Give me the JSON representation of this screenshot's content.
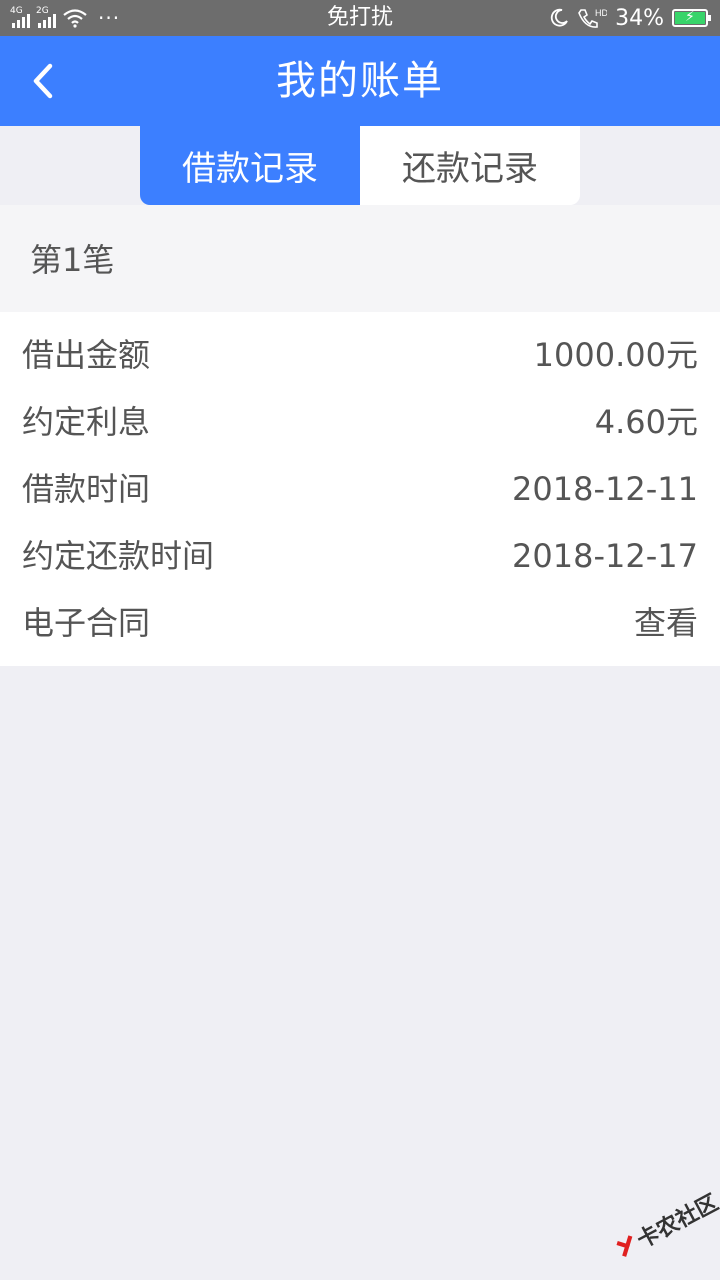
{
  "status_bar": {
    "network_1": "4G",
    "network_2": "2G",
    "more": "···",
    "mode": "免打扰",
    "battery_percent": "34%",
    "battery_level": 0.34,
    "icons": [
      "signal-icon",
      "wifi-icon",
      "moon-icon",
      "hd-call-icon",
      "battery-icon"
    ]
  },
  "header": {
    "title": "我的账单"
  },
  "tabs": [
    {
      "label": "借款记录",
      "active": true
    },
    {
      "label": "还款记录",
      "active": false
    }
  ],
  "section": {
    "title": "第1笔"
  },
  "details": [
    {
      "label": "借出金额",
      "value": "1000.00元"
    },
    {
      "label": "约定利息",
      "value": "4.60元"
    },
    {
      "label": "借款时间",
      "value": "2018-12-11"
    },
    {
      "label": "约定还款时间",
      "value": "2018-12-17"
    },
    {
      "label": "电子合同",
      "value": "查看"
    }
  ],
  "watermark": {
    "text": "卡农社区"
  },
  "colors": {
    "primary": "#3c7fff",
    "background": "#efeff4",
    "status_bar": "#6d6d6d"
  }
}
